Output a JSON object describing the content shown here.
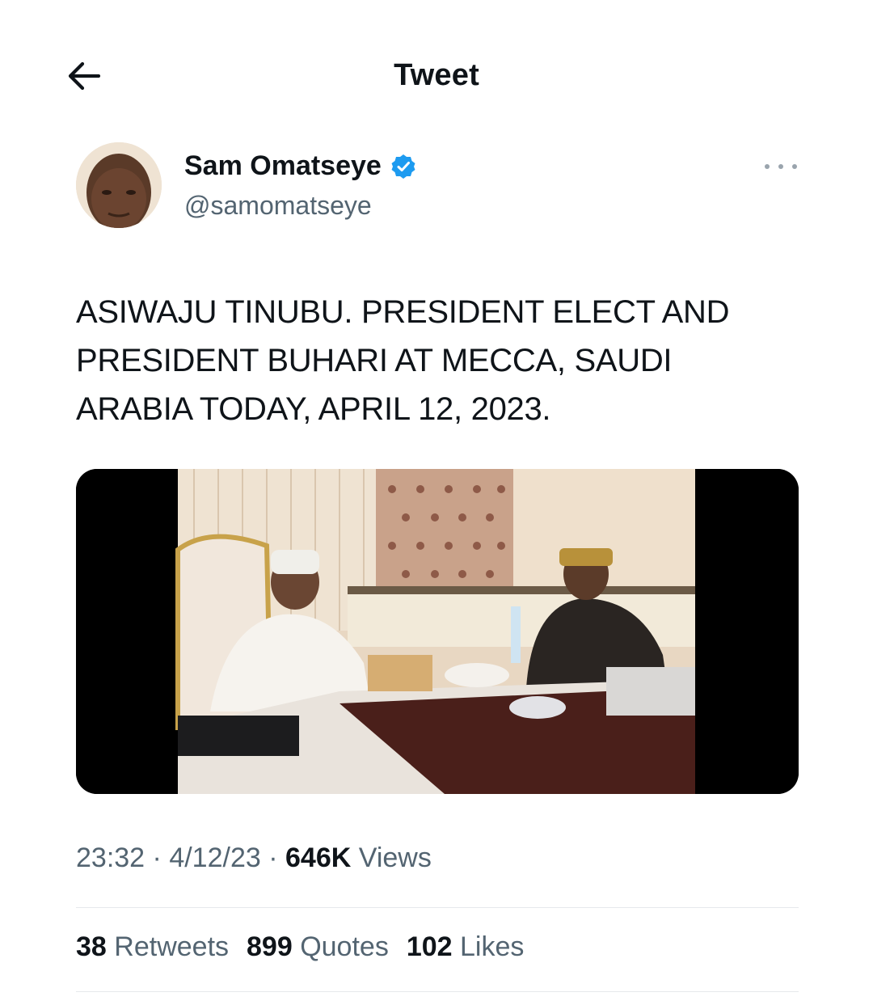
{
  "header": {
    "title": "Tweet",
    "back_icon": "back-arrow-icon"
  },
  "author": {
    "name": "Sam Omatseye",
    "handle": "@samomatseye",
    "verified_color": "#1d9bf0"
  },
  "tweet": {
    "text_lines": [
      "ASIWAJU TINUBU. PRESIDENT ELECT AND",
      "PRESIDENT BUHARI AT MECCA, SAUDI",
      "ARABIA TODAY, APRIL 12, 2023."
    ],
    "time": "23:32",
    "date": "4/12/23",
    "views_count": "646K",
    "views_label": "Views"
  },
  "stats": {
    "retweets_count": "38",
    "retweets_label": "Retweets",
    "quotes_count": "899",
    "quotes_label": "Quotes",
    "likes_count": "102",
    "likes_label": "Likes"
  },
  "colors": {
    "text": "#0f1419",
    "muted": "#536471",
    "divider": "#e6e9ec"
  }
}
